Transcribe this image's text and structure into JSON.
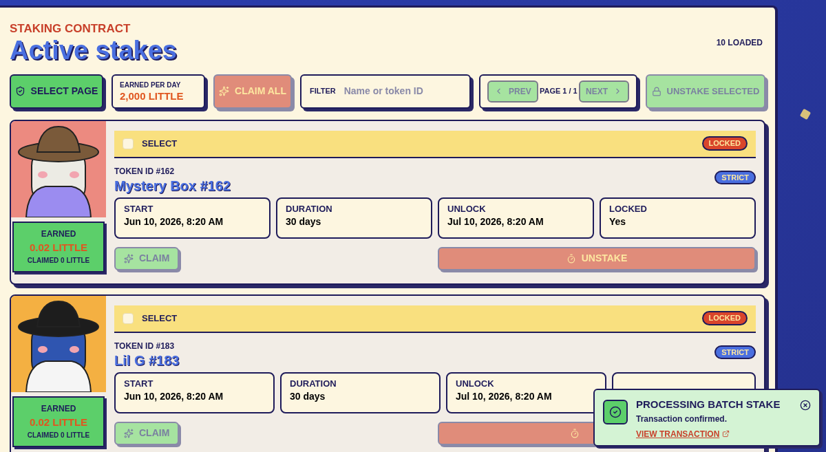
{
  "header": {
    "eyebrow": "STAKING CONTRACT",
    "title": "Active stakes",
    "loaded": "10 LOADED"
  },
  "toolbar": {
    "select_page": {
      "label": "SELECT PAGE"
    },
    "earned_per_day": {
      "label": "EARNED PER DAY",
      "value": "2,000 LITTLE"
    },
    "claim_all": {
      "label": "CLAIM ALL",
      "disabled": true
    },
    "filter": {
      "label": "FILTER",
      "placeholder": "Name or token ID"
    },
    "pager": {
      "prev": {
        "label": "PREV",
        "disabled": true
      },
      "page": "PAGE 1 / 1",
      "next": {
        "label": "NEXT",
        "disabled": true
      }
    },
    "unstake_selected": {
      "label": "UNSTAKE SELECTED",
      "disabled": true
    }
  },
  "stakes": [
    {
      "select": {
        "label": "SELECT",
        "checked": false
      },
      "status": "LOCKED",
      "token_id": "TOKEN ID #162",
      "name": "Mystery Box #162",
      "mode": "STRICT",
      "earned": {
        "label": "EARNED",
        "value": "0.02 LITTLE",
        "claimed": "CLAIMED 0 LITTLE"
      },
      "fields": [
        {
          "label": "START",
          "value": "Jun 10, 2026, 8:20 AM"
        },
        {
          "label": "DURATION",
          "value": "30 days"
        },
        {
          "label": "UNLOCK",
          "value": "Jul 10, 2026, 8:20 AM"
        },
        {
          "label": "LOCKED",
          "value": "Yes"
        }
      ],
      "claim": {
        "label": "CLAIM",
        "disabled": true
      },
      "unstake": {
        "label": "UNSTAKE",
        "disabled": true
      }
    },
    {
      "select": {
        "label": "SELECT",
        "checked": false
      },
      "status": "LOCKED",
      "token_id": "TOKEN ID #183",
      "name": "Lil G #183",
      "mode": "STRICT",
      "earned": {
        "label": "EARNED",
        "value": "0.02 LITTLE",
        "claimed": "CLAIMED 0 LITTLE"
      },
      "fields": [
        {
          "label": "START",
          "value": "Jun 10, 2026, 8:20 AM"
        },
        {
          "label": "DURATION",
          "value": "30 days"
        },
        {
          "label": "UNLOCK",
          "value": "Jul 10, 2026, 8:20 AM"
        },
        {
          "kind": "covered"
        }
      ],
      "claim": {
        "label": "CLAIM",
        "disabled": true
      },
      "unstake": {
        "disabled": true
      }
    }
  ],
  "toast": {
    "title": "PROCESSING BATCH STAKE",
    "message": "Transaction confirmed.",
    "link": "VIEW TRANSACTION"
  }
}
